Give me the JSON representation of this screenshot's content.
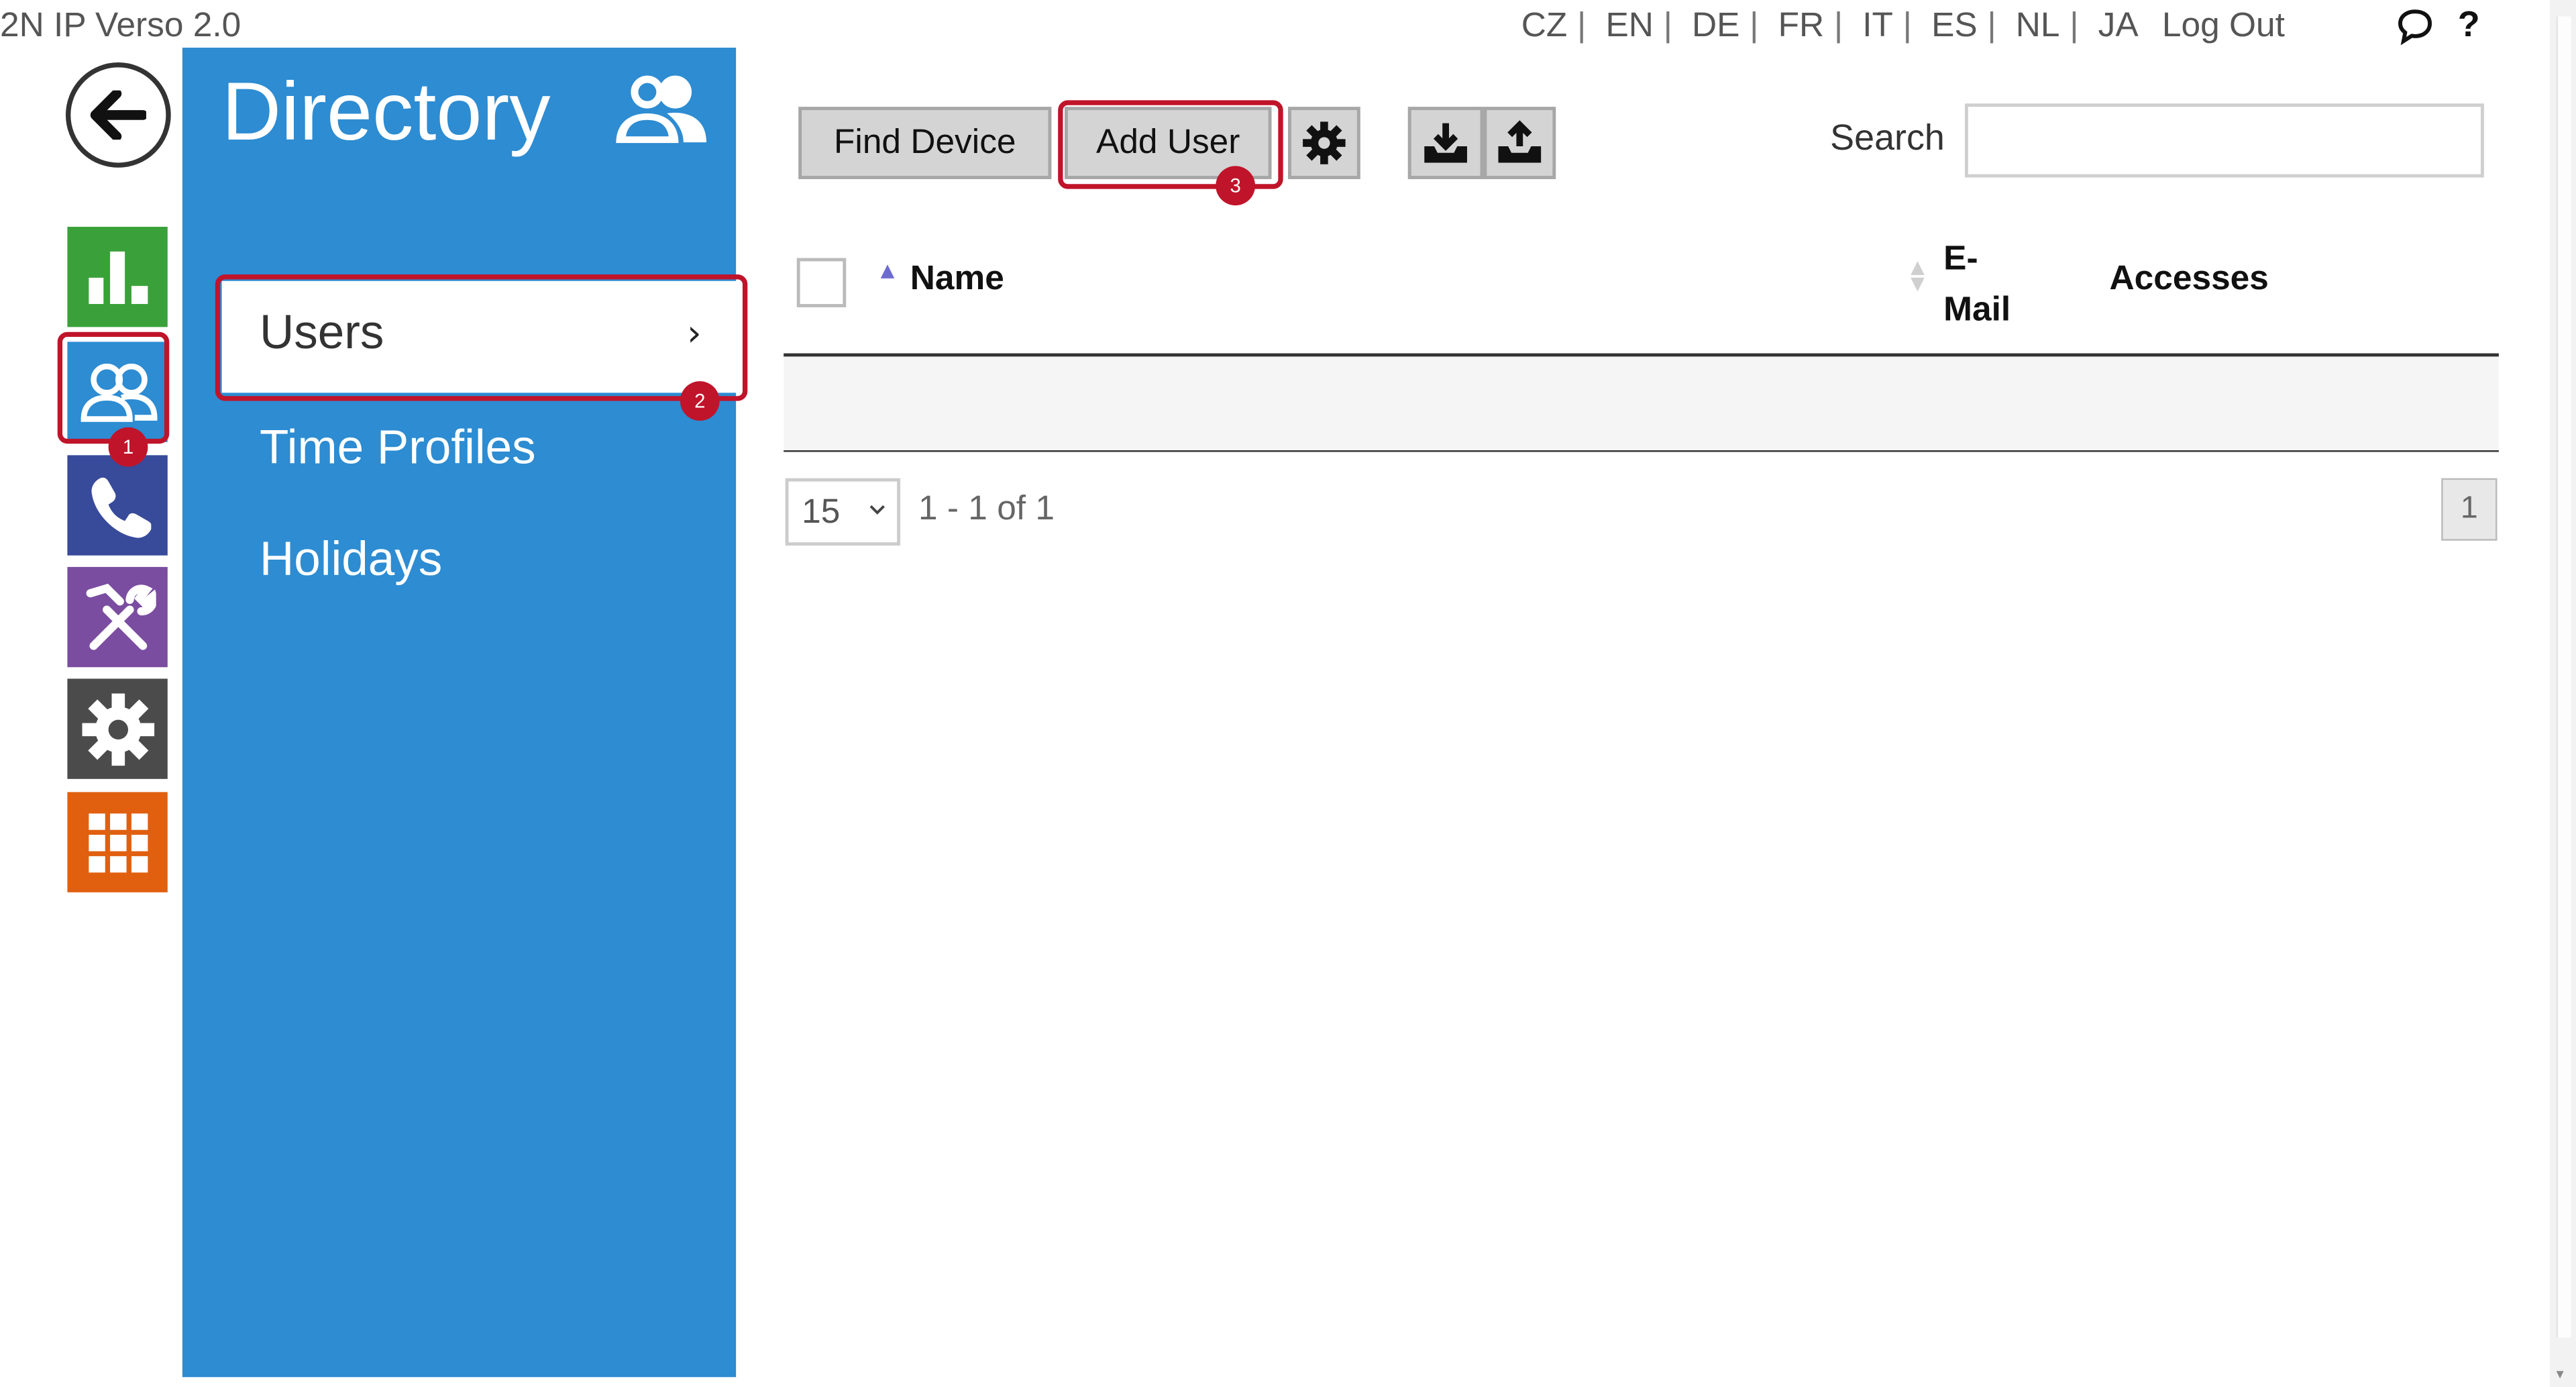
{
  "header": {
    "model": "2N IP Verso 2.0",
    "languages": [
      "CZ",
      "EN",
      "DE",
      "FR",
      "IT",
      "ES",
      "NL",
      "JA"
    ],
    "logout_label": "Log Out",
    "help_label": "?"
  },
  "rail": {
    "items": [
      "status",
      "directory",
      "calls",
      "hardware",
      "system",
      "services"
    ]
  },
  "panel": {
    "title": "Directory",
    "menu": [
      {
        "label": "Users",
        "chevron": "›"
      },
      {
        "label": "Time Profiles"
      },
      {
        "label": "Holidays"
      }
    ]
  },
  "toolbar": {
    "find_device_label": "Find Device",
    "add_user_label": "Add User",
    "search_label": "Search",
    "search_value": ""
  },
  "table": {
    "columns": [
      "Name",
      "E-Mail",
      "Accesses"
    ],
    "email_lines": [
      "E-",
      "Mail"
    ],
    "rows": []
  },
  "pagination": {
    "page_size": "15",
    "range_text": "1 - 1 of 1",
    "current_page": "1"
  },
  "annotations": {
    "step1": "1",
    "step2": "2",
    "step3": "3",
    "highlight_color": "#c0142a"
  },
  "colors": {
    "panel_blue": "#2d8cd2",
    "status_green": "#3aa13a",
    "calls_indigo": "#384a9a",
    "hardware_purple": "#7a4da0",
    "system_gray": "#4b4b4b",
    "services_orange": "#e0600f"
  }
}
